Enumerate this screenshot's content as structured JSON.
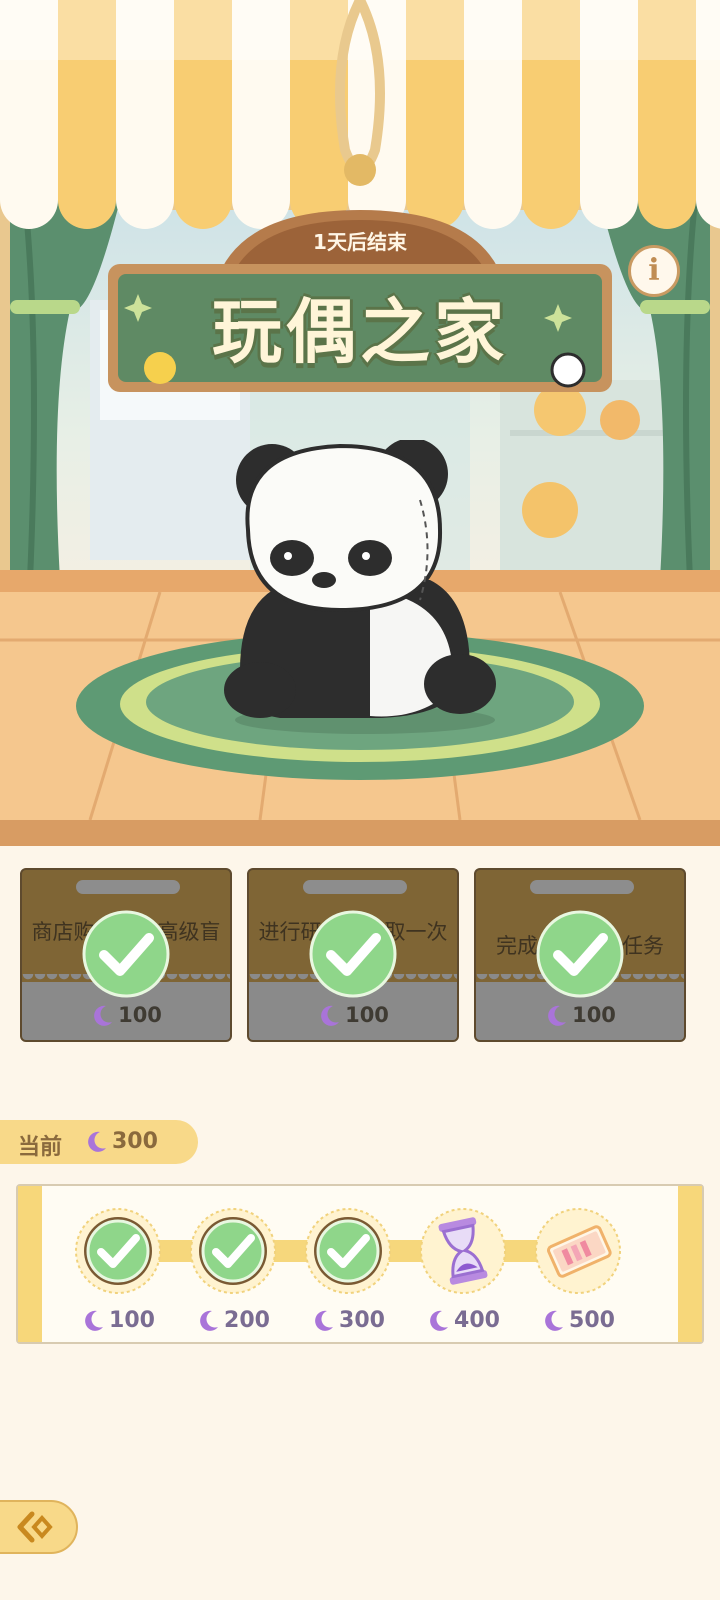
{
  "event": {
    "countdown": "1天后结束",
    "title": "玩偶之家",
    "info_icon": "i"
  },
  "tasks": [
    {
      "desc": "商店购买一次高级盲盒抽奖券",
      "reward": "100",
      "status": "completed"
    },
    {
      "desc": "进行研究并领取一次",
      "reward": "100",
      "status": "completed"
    },
    {
      "desc": "完成一次每日任务",
      "reward": "100",
      "status": "completed"
    }
  ],
  "progress": {
    "current_label": "当前",
    "current_value": "300",
    "milestones": [
      {
        "value": "100",
        "reward_icon": "box-icon",
        "claimed": true
      },
      {
        "value": "200",
        "reward_icon": "box-icon",
        "claimed": true
      },
      {
        "value": "300",
        "reward_icon": "box-icon",
        "claimed": true
      },
      {
        "value": "400",
        "reward_icon": "hourglass-icon",
        "claimed": false
      },
      {
        "value": "500",
        "reward_icon": "ticket-icon",
        "claimed": false
      }
    ]
  },
  "colors": {
    "accent_yellow": "#f8d989",
    "check_green": "#8fd68a",
    "moon_purple": "#a974d9"
  }
}
